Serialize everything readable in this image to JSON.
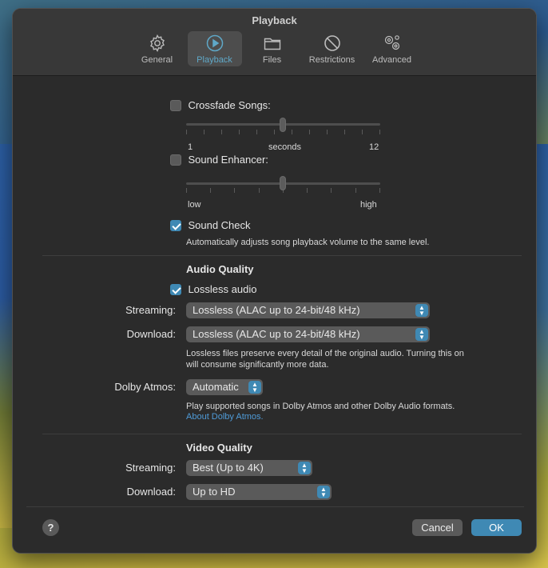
{
  "window": {
    "title": "Playback"
  },
  "tabs": [
    {
      "label": "General",
      "icon": "gear-icon"
    },
    {
      "label": "Playback",
      "icon": "play-circle-icon",
      "active": true
    },
    {
      "label": "Files",
      "icon": "folder-icon"
    },
    {
      "label": "Restrictions",
      "icon": "no-sign-icon"
    },
    {
      "label": "Advanced",
      "icon": "gears-icon"
    }
  ],
  "crossfade": {
    "label": "Crossfade Songs:",
    "checked": false,
    "min": "1",
    "unit": "seconds",
    "max": "12",
    "value_fraction": 0.5
  },
  "sound_enhancer": {
    "label": "Sound Enhancer:",
    "checked": false,
    "low": "low",
    "high": "high",
    "value_fraction": 0.5
  },
  "sound_check": {
    "label": "Sound Check",
    "checked": true,
    "description": "Automatically adjusts song playback volume to the same level."
  },
  "audio_quality": {
    "heading": "Audio Quality",
    "lossless_label": "Lossless audio",
    "lossless_checked": true,
    "streaming_label": "Streaming:",
    "streaming_value": "Lossless (ALAC up to 24-bit/48 kHz)",
    "download_label": "Download:",
    "download_value": "Lossless (ALAC up to 24-bit/48 kHz)",
    "note_line1": "Lossless files preserve every detail of the original audio. Turning this on",
    "note_line2": "will consume significantly more data.",
    "dolby_label": "Dolby Atmos:",
    "dolby_value": "Automatic",
    "dolby_note": "Play supported songs in Dolby Atmos and other Dolby Audio formats.",
    "dolby_link": "About Dolby Atmos."
  },
  "video_quality": {
    "heading": "Video Quality",
    "streaming_label": "Streaming:",
    "streaming_value": "Best (Up to 4K)",
    "download_label": "Download:",
    "download_value": "Up to HD"
  },
  "footer": {
    "help": "?",
    "cancel": "Cancel",
    "ok": "OK"
  },
  "colors": {
    "accent": "#3f89b4",
    "link": "#4f9bd8",
    "window_bg": "#2b2b2b"
  }
}
